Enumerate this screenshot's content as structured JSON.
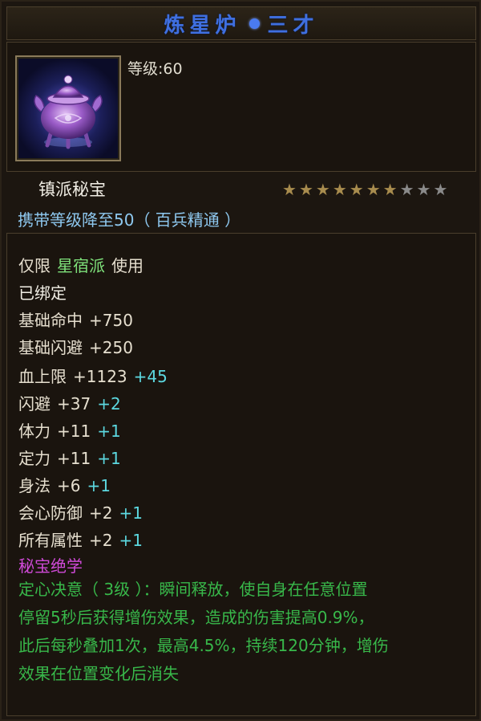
{
  "item": {
    "name": "炼星炉",
    "quality": "三才",
    "level_label": "等级:60",
    "treasure_type": "镇派秘宝",
    "stars_total": 10,
    "stars_lit": 7,
    "carry_text": "携带等级降至50（ 百兵精通 ）",
    "restriction": {
      "prefix": "仅限",
      "sect": "星宿派",
      "suffix": "使用"
    },
    "bound": "已绑定",
    "base_stats": [
      {
        "name": "基础命中",
        "value": "+750"
      },
      {
        "name": "基础闪避",
        "value": "+250"
      }
    ],
    "stats": [
      {
        "name": "血上限",
        "value": "+1123",
        "bonus": "+45"
      },
      {
        "name": "闪避",
        "value": "+37",
        "bonus": "+2"
      },
      {
        "name": "体力",
        "value": "+11",
        "bonus": "+1"
      },
      {
        "name": "定力",
        "value": "+11",
        "bonus": "+1"
      },
      {
        "name": "身法",
        "value": "+6",
        "bonus": "+1"
      },
      {
        "name": "会心防御",
        "value": "+2",
        "bonus": "+1"
      },
      {
        "name": "所有属性",
        "value": "+2",
        "bonus": "+1"
      }
    ],
    "skill_header": "秘宝绝学",
    "skill_lines": [
      "定心决意（ 3级 ）：瞬间释放，使自身在任意位置",
      "停留5秒后获得增伤效果，造成的伤害提高0.9%，",
      "此后每秒叠加1次，最高4.5%，持续120分钟，增伤",
      "效果在位置变化后消失"
    ],
    "icon": "purple-censer-icon"
  },
  "colors": {
    "title": "#3f6fe0",
    "sect": "#7ee07a",
    "bonus": "#5cd8e0",
    "skill_header": "#d04ad8",
    "skill_text": "#38b84a",
    "carry": "#8ec8ef"
  }
}
